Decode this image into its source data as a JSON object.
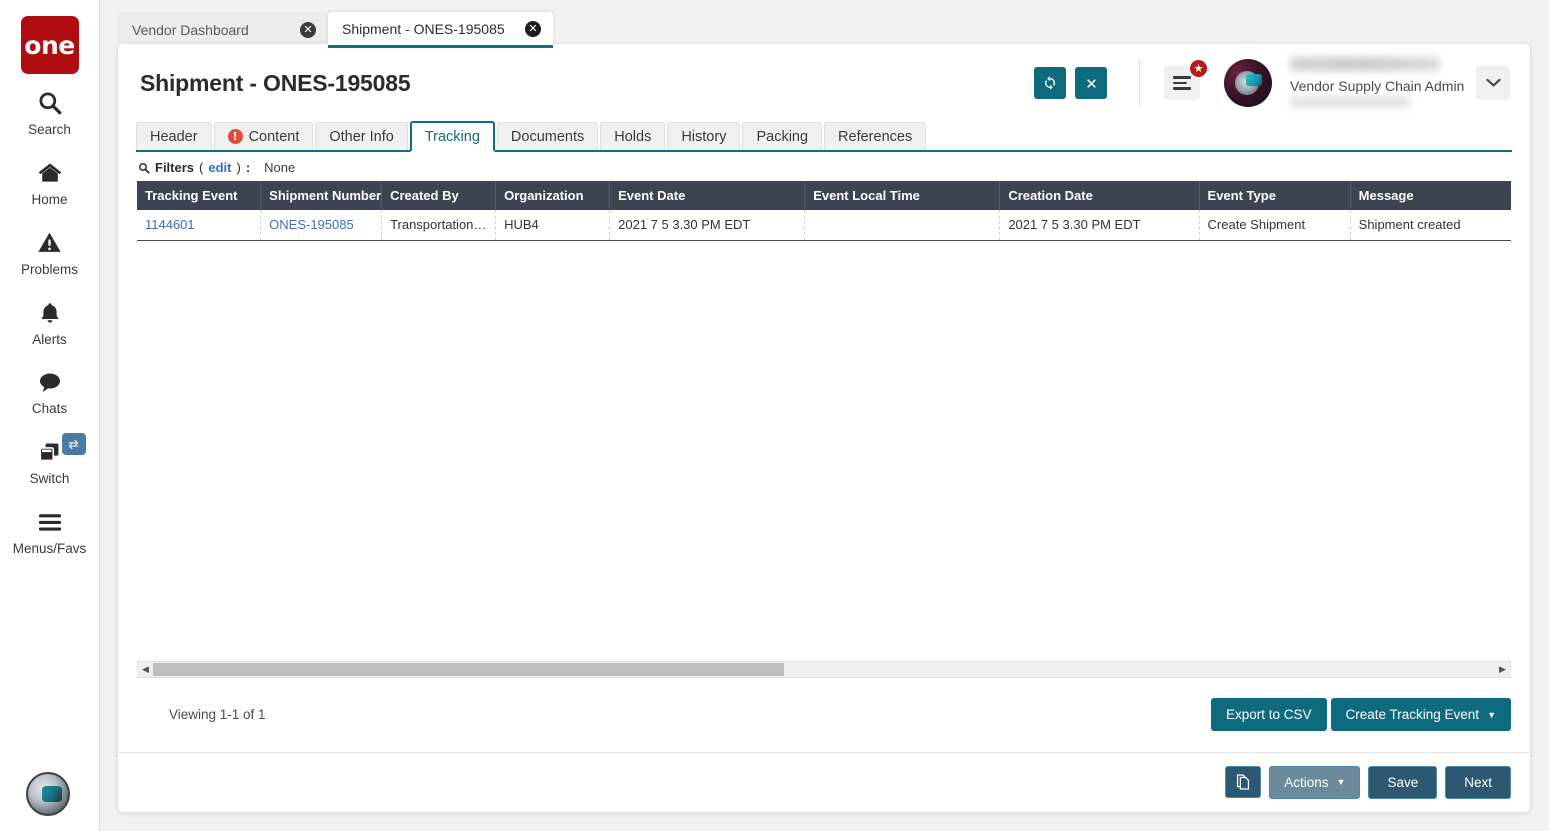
{
  "sidebar": {
    "logo_text": "one",
    "items": [
      {
        "label": "Search",
        "icon": "search-icon"
      },
      {
        "label": "Home",
        "icon": "home-icon"
      },
      {
        "label": "Problems",
        "icon": "warning-triangle-icon"
      },
      {
        "label": "Alerts",
        "icon": "bell-icon"
      },
      {
        "label": "Chats",
        "icon": "chat-bubble-icon"
      },
      {
        "label": "Switch",
        "icon": "windows-stack-icon",
        "badge_icon": "exchange-arrows-icon"
      },
      {
        "label": "Menus/Favs",
        "icon": "hamburger-icon"
      }
    ]
  },
  "browser_tabs": [
    {
      "label": "Vendor Dashboard",
      "active": false
    },
    {
      "label": "Shipment - ONES-195085",
      "active": true
    }
  ],
  "header": {
    "title": "Shipment - ONES-195085",
    "refresh_icon": "refresh-icon",
    "close_icon": "close-x-icon",
    "menu_icon": "hamburger-menu-icon",
    "notification_badge": "★",
    "user_role": "Vendor Supply Chain Admin",
    "chevron_icon": "chevron-down-icon"
  },
  "content_tabs": [
    {
      "label": "Header",
      "active": false,
      "warning": false
    },
    {
      "label": "Content",
      "active": false,
      "warning": true
    },
    {
      "label": "Other Info",
      "active": false,
      "warning": false
    },
    {
      "label": "Tracking",
      "active": true,
      "warning": false
    },
    {
      "label": "Documents",
      "active": false,
      "warning": false
    },
    {
      "label": "Holds",
      "active": false,
      "warning": false
    },
    {
      "label": "History",
      "active": false,
      "warning": false
    },
    {
      "label": "Packing",
      "active": false,
      "warning": false
    },
    {
      "label": "References",
      "active": false,
      "warning": false
    }
  ],
  "filters": {
    "icon": "search-icon",
    "label": "Filters",
    "edit_label": "edit",
    "colon": ":",
    "value": "None"
  },
  "table": {
    "columns": [
      "Tracking Event",
      "Shipment Number",
      "Created By",
      "Organization",
      "Event Date",
      "Event Local Time",
      "Creation Date",
      "Event Type",
      "Message"
    ],
    "rows": [
      {
        "tracking_event": "1144601",
        "shipment_number": "ONES-195085",
        "created_by": "TransportationAd...",
        "organization": "HUB4",
        "event_date": "2021 7 5 3.30 PM EDT",
        "event_local_time": "",
        "creation_date": "2021 7 5 3.30 PM EDT",
        "event_type": "Create Shipment",
        "message": "Shipment created"
      }
    ]
  },
  "pagination": {
    "viewing_text": "Viewing 1-1 of 1"
  },
  "grid_actions": {
    "export_label": "Export to CSV",
    "create_label": "Create Tracking Event",
    "create_caret": "▼"
  },
  "footer": {
    "copy_icon": "copy-pages-icon",
    "actions_label": "Actions",
    "actions_caret": "▼",
    "save_label": "Save",
    "next_label": "Next"
  },
  "colors": {
    "brand_red": "#b00d10",
    "teal": "#0d6b7d",
    "navy": "#2c5871",
    "table_header": "#3b4450",
    "link_blue": "#3d6fb8",
    "warning_red": "#e04e39"
  }
}
